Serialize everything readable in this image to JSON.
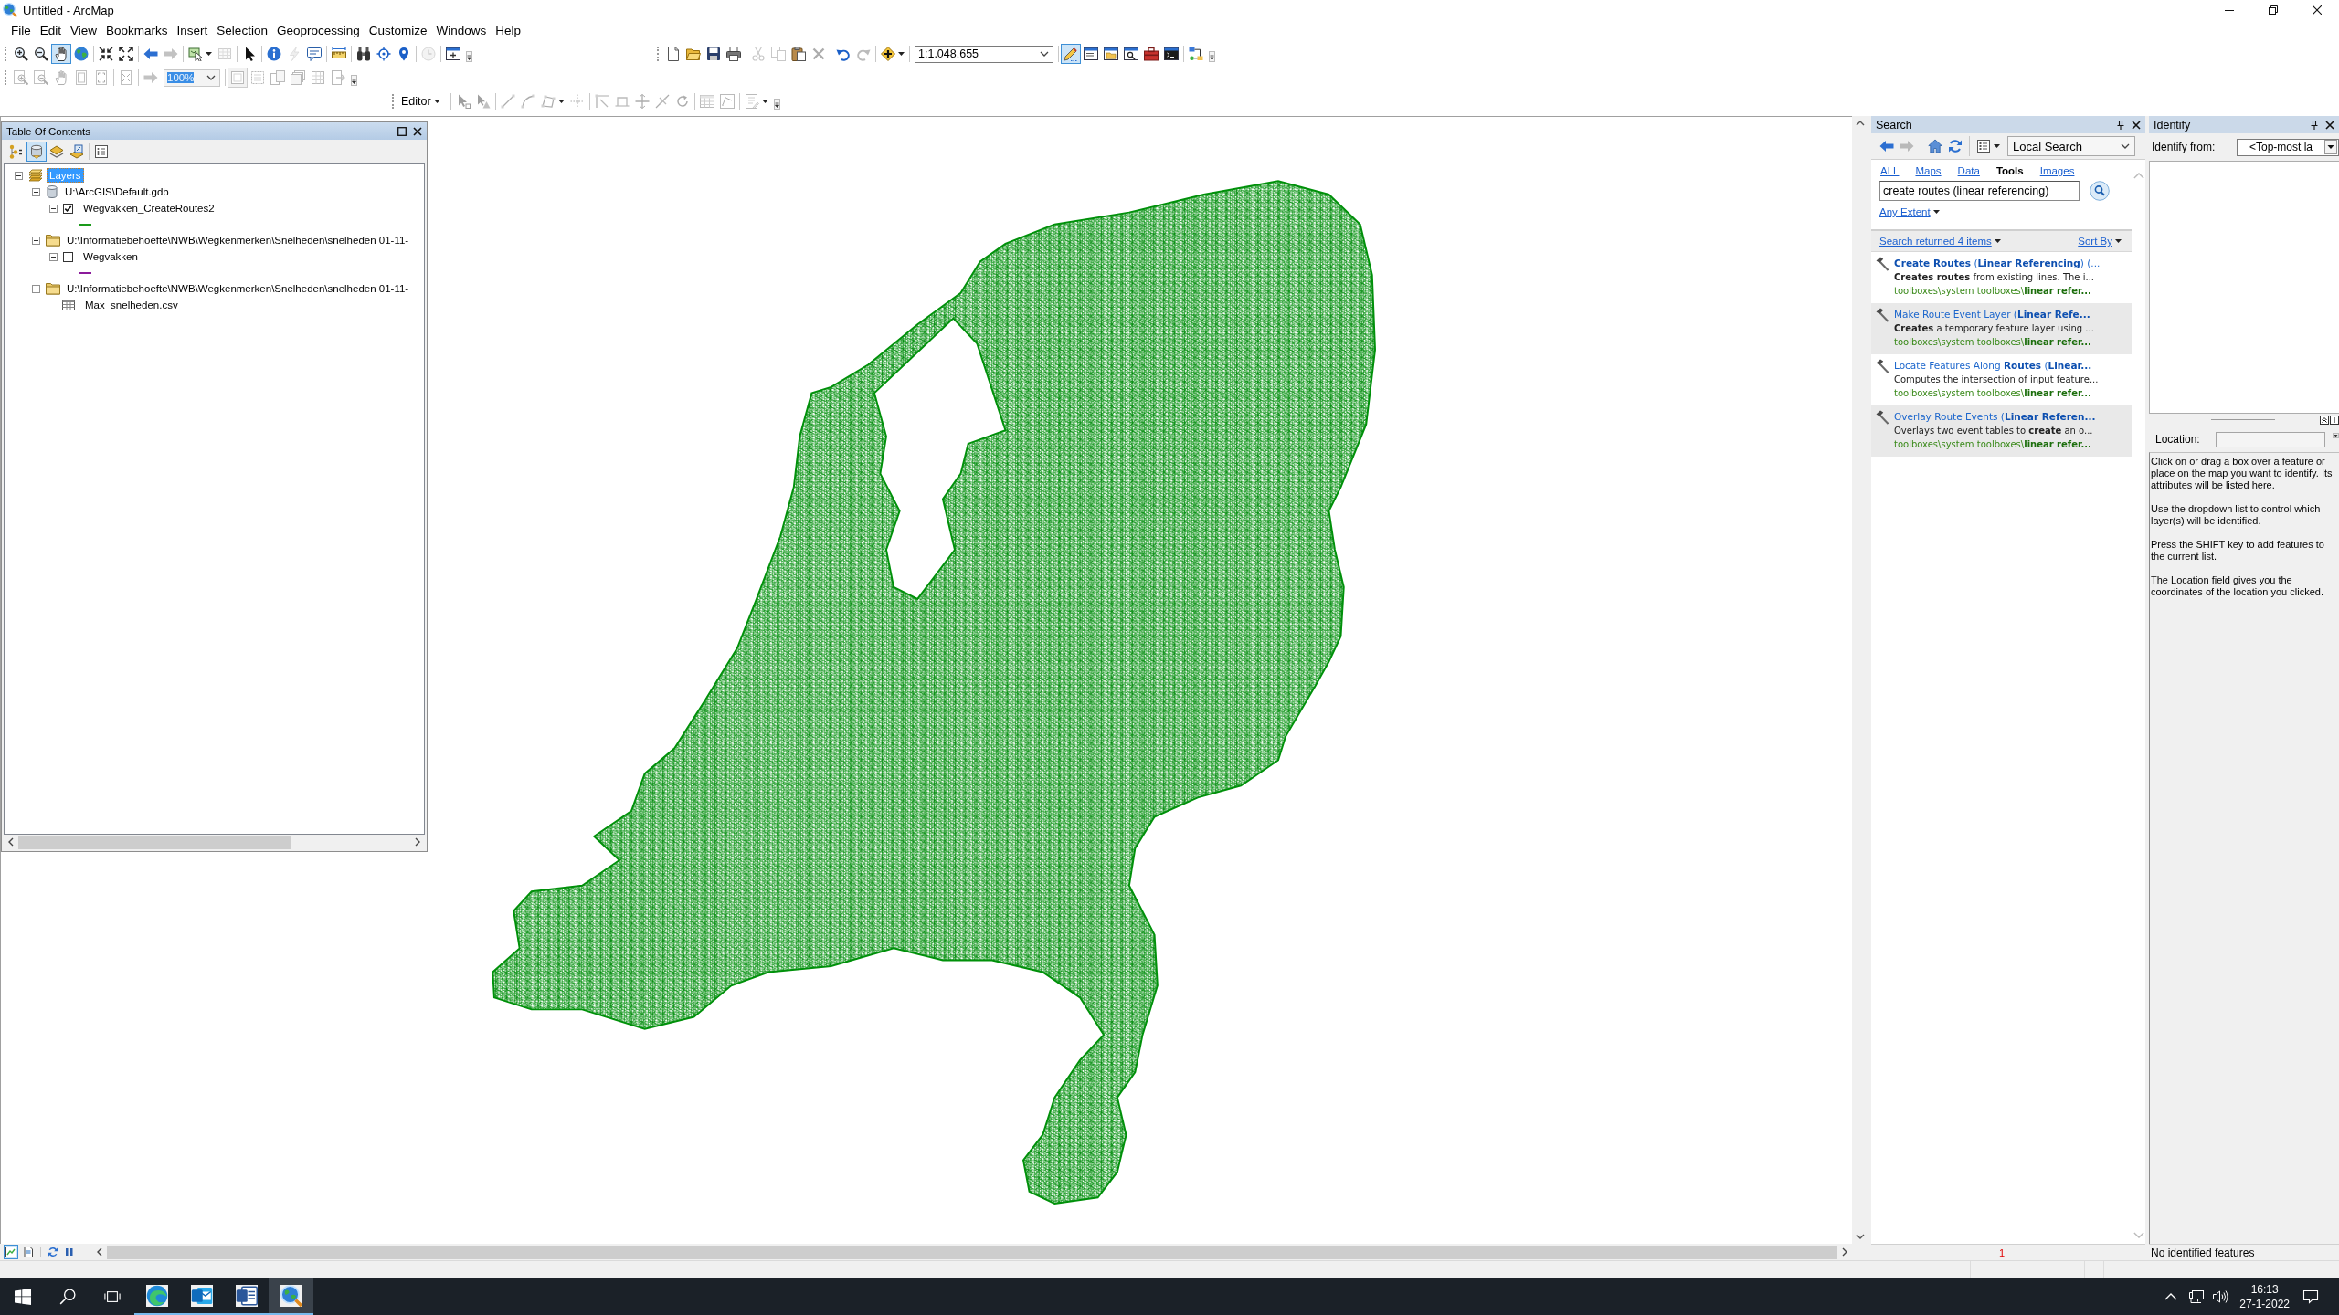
{
  "window": {
    "title": "Untitled - ArcMap"
  },
  "menu_bar": [
    "File",
    "Edit",
    "View",
    "Bookmarks",
    "Insert",
    "Selection",
    "Geoprocessing",
    "Customize",
    "Windows",
    "Help"
  ],
  "toolbars": {
    "tools": {
      "buttons": [
        {
          "selected": false,
          "disabled": false
        },
        {
          "selected": false,
          "disabled": false
        },
        {
          "selected": true,
          "disabled": false
        },
        {
          "selected": false,
          "disabled": false
        },
        {
          "selected": false,
          "disabled": false
        },
        {
          "selected": false,
          "disabled": false
        },
        {
          "selected": false,
          "disabled": false
        },
        {
          "selected": false,
          "disabled": true
        },
        {
          "selected": false,
          "disabled": false
        },
        {
          "selected": false,
          "disabled": true
        },
        {
          "selected": false,
          "disabled": false
        },
        {
          "selected": false,
          "disabled": false
        },
        {
          "selected": false,
          "disabled": true
        },
        {
          "selected": false,
          "disabled": false
        },
        {
          "selected": false,
          "disabled": false
        },
        {
          "selected": false,
          "disabled": false
        },
        {
          "selected": false,
          "disabled": false
        },
        {
          "selected": false,
          "disabled": false
        },
        {
          "selected": false,
          "disabled": true
        },
        {
          "selected": false,
          "disabled": false
        }
      ]
    },
    "standard": {
      "buttons": [
        {
          "selected": false,
          "disabled": false
        },
        {
          "selected": false,
          "disabled": false
        },
        {
          "selected": false,
          "disabled": false
        },
        {
          "selected": false,
          "disabled": false
        },
        {
          "selected": false,
          "disabled": true
        },
        {
          "selected": false,
          "disabled": true
        },
        {
          "selected": false,
          "disabled": false
        },
        {
          "selected": false,
          "disabled": true
        },
        {
          "selected": false,
          "disabled": false
        },
        {
          "selected": false,
          "disabled": true
        },
        {
          "selected": false,
          "disabled": false
        },
        {
          "selected": true,
          "disabled": false
        },
        {
          "selected": false,
          "disabled": false
        },
        {
          "selected": false,
          "disabled": false
        },
        {
          "selected": false,
          "disabled": false
        },
        {
          "selected": false,
          "disabled": false
        },
        {
          "selected": false,
          "disabled": false
        },
        {
          "selected": false,
          "disabled": false
        }
      ],
      "scale": "1:1.048.655"
    },
    "layout": {
      "buttons": [
        {
          "selected": false,
          "disabled": true
        },
        {
          "selected": false,
          "disabled": true
        },
        {
          "selected": false,
          "disabled": true
        },
        {
          "selected": false,
          "disabled": true
        },
        {
          "selected": false,
          "disabled": true
        },
        {
          "selected": false,
          "disabled": true
        },
        {
          "selected": false,
          "disabled": true
        },
        {
          "selected": true,
          "disabled": true
        },
        {
          "selected": false,
          "disabled": true
        },
        {
          "selected": false,
          "disabled": true
        },
        {
          "selected": false,
          "disabled": true
        },
        {
          "selected": false,
          "disabled": true
        },
        {
          "selected": false,
          "disabled": true
        }
      ],
      "zoom": "100%",
      "zoom_highlighted": true
    },
    "editor": {
      "menu": "Editor",
      "buttons": [
        {
          "selected": false,
          "disabled": true
        },
        {
          "selected": false,
          "disabled": true
        },
        {
          "selected": false,
          "disabled": true
        },
        {
          "selected": false,
          "disabled": true
        },
        {
          "selected": false,
          "disabled": true
        },
        {
          "selected": false,
          "disabled": true
        },
        {
          "selected": false,
          "disabled": true
        },
        {
          "selected": false,
          "disabled": true
        },
        {
          "selected": false,
          "disabled": true
        },
        {
          "selected": false,
          "disabled": true
        },
        {
          "selected": false,
          "disabled": true
        },
        {
          "selected": false,
          "disabled": true
        },
        {
          "selected": false,
          "disabled": true
        },
        {
          "selected": false,
          "disabled": true
        }
      ]
    }
  },
  "table_of_contents": {
    "title": "Table Of Contents",
    "toolbar_buttons": [
      {
        "selected": false
      },
      {
        "selected": true
      },
      {
        "selected": false
      },
      {
        "selected": false
      },
      {
        "selected": false
      }
    ],
    "tree": [
      {
        "label": "Layers",
        "kind": "frame",
        "selected": true,
        "expanded": true,
        "children": [
          {
            "label": "U:\\ArcGIS\\Default.gdb",
            "kind": "database",
            "selected": false,
            "expanded": true,
            "children": [
              {
                "label": "Wegvakken_CreateRoutes2",
                "kind": "layer",
                "selected": false,
                "expanded": true,
                "checked": true,
                "color": "#1a9a1a"
              }
            ]
          },
          {
            "label": "U:\\Informatiebehoefte\\NWB\\Wegkenmerken\\Snelheden\\snelheden 01-11-",
            "kind": "folder",
            "selected": false,
            "expanded": true,
            "children": [
              {
                "label": "Wegvakken",
                "kind": "layer",
                "selected": false,
                "expanded": true,
                "checked": false,
                "color": "#8b1a9b"
              }
            ]
          },
          {
            "label": "U:\\Informatiebehoefte\\NWB\\Wegkenmerken\\Snelheden\\snelheden 01-11-",
            "kind": "folder",
            "selected": false,
            "expanded": true,
            "children": [
              {
                "label": "Max_snelheden.csv",
                "kind": "table",
                "selected": false
              }
            ]
          }
        ]
      }
    ]
  },
  "map": {
    "view_buttons": [
      {
        "selected": true
      },
      {
        "selected": false
      }
    ]
  },
  "search": {
    "title": "Search",
    "toolbar_buttons": [
      {
        "disabled": false
      },
      {
        "disabled": true
      },
      {
        "disabled": false
      },
      {
        "disabled": false
      },
      {
        "disabled": false
      }
    ],
    "scope": "Local Search",
    "tabs": [
      {
        "label": "ALL",
        "selected": false
      },
      {
        "label": "Maps",
        "selected": false
      },
      {
        "label": "Data",
        "selected": false
      },
      {
        "label": "Tools",
        "selected": true
      },
      {
        "label": "Images",
        "selected": false
      }
    ],
    "query": "create routes (linear referencing)",
    "extent": "Any Extent",
    "result_count": "Search returned 4 items",
    "sort": "Sort By",
    "results": [
      {
        "title": "**Create Routes** (**Linear Referencing**) (...",
        "description": "**Creates routes** from existing lines. The i...",
        "path": "toolboxes\\system toolboxes\\**linear refer...**"
      },
      {
        "title": "Make Route Event Layer (**Linear Refe...**",
        "description": "**Creates** a temporary feature layer using ...",
        "path": "toolboxes\\system toolboxes\\**linear refer...**"
      },
      {
        "title": "Locate Features Along **Routes** (**Linear...**",
        "description": "Computes the intersection of input feature...",
        "path": "toolboxes\\system toolboxes\\**linear refer...**"
      },
      {
        "title": "Overlay Route Events (**Linear Referen...**",
        "description": "Overlays two event tables to **create** an o...",
        "path": "toolboxes\\system toolboxes\\**linear refer...**"
      }
    ],
    "footer": "1"
  },
  "identify": {
    "title": "Identify",
    "from_label": "Identify from:",
    "from_value": "<Top-most la",
    "location_label": "Location:",
    "help": [
      "Click on or drag a box over a feature or place on the map you want to identify. Its attributes will be listed here.",
      "Use the dropdown list to control which layer(s) will be identified.",
      "Press the SHIFT key to add features to the current list.",
      "The Location field gives you the coordinates of the location you clicked."
    ],
    "status": "No identified features"
  },
  "taskbar": {
    "apps": [
      {
        "running": true,
        "selected": false
      },
      {
        "running": true,
        "selected": false
      },
      {
        "running": true,
        "selected": false
      },
      {
        "running": true,
        "selected": true
      }
    ],
    "time": "16:13",
    "date": "27-1-2022"
  }
}
